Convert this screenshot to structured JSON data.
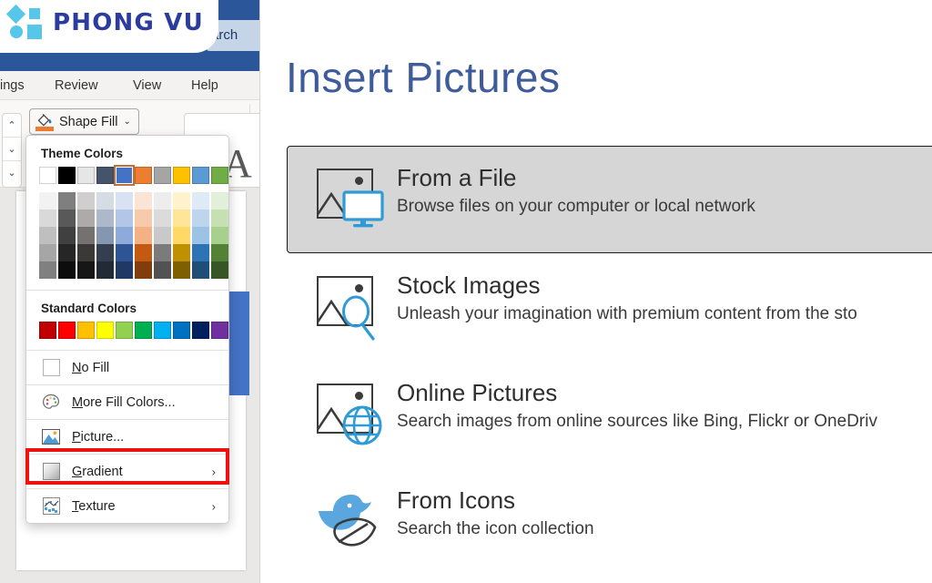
{
  "brand": {
    "name": "PHONG VU",
    "logo_icon": "phong-vu-diamond-square-logo",
    "accent_color": "#56c7e8",
    "text_color": "#2b3b9e"
  },
  "office_window": {
    "titlebar_color": "#2b579a",
    "search_box_text": "arch",
    "tabs": [
      {
        "label": "ings"
      },
      {
        "label": "Review"
      },
      {
        "label": "View"
      },
      {
        "label": "Help"
      }
    ],
    "spinners": [
      {
        "icon": "chevron-up-icon",
        "glyph": "⌃"
      },
      {
        "icon": "chevron-down-icon",
        "glyph": "⌄"
      },
      {
        "icon": "more-options-icon",
        "glyph": "⌄"
      }
    ],
    "ribbon": {
      "shape_fill_button": {
        "label": "Shape Fill",
        "icon": "paint-bucket-icon",
        "dropdown_glyph": "⌄",
        "fill_indicator_color": "#ed7d31"
      },
      "wordart_gallery_letter": "A"
    },
    "document_shape_color": "#4472c4"
  },
  "fill_menu": {
    "theme_colors_heading": "Theme Colors",
    "theme_colors": [
      {
        "name": "white-background-1",
        "hex": "#ffffff"
      },
      {
        "name": "black-text-1",
        "hex": "#000000"
      },
      {
        "name": "light-gray-background-2",
        "hex": "#e7e6e6"
      },
      {
        "name": "dark-blue-text-2",
        "hex": "#44546a"
      },
      {
        "name": "blue-accent-1",
        "hex": "#4472c4",
        "selected": true
      },
      {
        "name": "orange-accent-2",
        "hex": "#ed7d31"
      },
      {
        "name": "gray-accent-3",
        "hex": "#a5a5a5"
      },
      {
        "name": "gold-accent-4",
        "hex": "#ffc000"
      },
      {
        "name": "blue-accent-5",
        "hex": "#5b9bd5"
      },
      {
        "name": "green-accent-6",
        "hex": "#70ad47"
      }
    ],
    "theme_variants": [
      [
        "#f2f2f2",
        "#d9d9d9",
        "#bfbfbf",
        "#a6a6a6",
        "#808080"
      ],
      [
        "#7f7f7f",
        "#595959",
        "#404040",
        "#262626",
        "#0d0d0d"
      ],
      [
        "#d0cece",
        "#aeaaaa",
        "#757171",
        "#3b3838",
        "#161616"
      ],
      [
        "#d6dce4",
        "#adb9ca",
        "#8496b0",
        "#333f4f",
        "#222a35"
      ],
      [
        "#d9e2f3",
        "#b4c6e7",
        "#8eaadb",
        "#2e5496",
        "#1f3864"
      ],
      [
        "#fbe4d5",
        "#f7caac",
        "#f4b183",
        "#c45911",
        "#833c0b"
      ],
      [
        "#ededed",
        "#dbdbdb",
        "#c9c9c9",
        "#7b7b7b",
        "#525252"
      ],
      [
        "#fff2cc",
        "#ffe598",
        "#ffd965",
        "#bf9000",
        "#7f6000"
      ],
      [
        "#deeaf6",
        "#bdd6ee",
        "#9cc3e5",
        "#2e74b5",
        "#1f4e79"
      ],
      [
        "#e2efd9",
        "#c5e0b3",
        "#a8d08d",
        "#538135",
        "#375623"
      ]
    ],
    "standard_colors_heading": "Standard Colors",
    "standard_colors": [
      {
        "name": "dark-red",
        "hex": "#c00000"
      },
      {
        "name": "red",
        "hex": "#ff0000"
      },
      {
        "name": "orange",
        "hex": "#ffc000"
      },
      {
        "name": "yellow",
        "hex": "#ffff00"
      },
      {
        "name": "light-green",
        "hex": "#92d050"
      },
      {
        "name": "green",
        "hex": "#00b050"
      },
      {
        "name": "light-blue",
        "hex": "#00b0f0"
      },
      {
        "name": "blue",
        "hex": "#0070c0"
      },
      {
        "name": "dark-blue",
        "hex": "#002060"
      },
      {
        "name": "purple",
        "hex": "#7030a0"
      }
    ],
    "items": [
      {
        "name": "no-fill",
        "label_pre": "",
        "label_key": "N",
        "label_post": "o Fill",
        "icon": "empty-square-icon",
        "has_submenu": false
      },
      {
        "name": "more-fill-colors",
        "label_pre": "",
        "label_key": "M",
        "label_post": "ore Fill Colors...",
        "icon": "color-palette-icon",
        "has_submenu": false
      },
      {
        "name": "picture",
        "label_pre": "",
        "label_key": "P",
        "label_post": "icture...",
        "icon": "picture-icon",
        "has_submenu": false,
        "highlighted": true
      },
      {
        "name": "gradient",
        "label_pre": "",
        "label_key": "G",
        "label_post": "radient",
        "icon": "gradient-icon",
        "has_submenu": true,
        "chevron": "›"
      },
      {
        "name": "texture",
        "label_pre": "",
        "label_key": "T",
        "label_post": "exture",
        "icon": "texture-icon",
        "has_submenu": true,
        "chevron": "›"
      }
    ],
    "highlight_color": "#ee1111"
  },
  "insert_pictures": {
    "title": "Insert Pictures",
    "title_color": "#3f5c9a",
    "options": [
      {
        "name": "from-a-file",
        "heading": "From a File",
        "description": "Browse files on your computer or local network",
        "icon": "picture-with-monitor-icon",
        "selected": true
      },
      {
        "name": "stock-images",
        "heading": "Stock Images",
        "description": "Unleash your imagination with premium content from the sto",
        "icon": "picture-with-magnifier-icon",
        "selected": false
      },
      {
        "name": "online-pictures",
        "heading": "Online Pictures",
        "description": "Search images from online sources like Bing, Flickr or OneDriv",
        "icon": "picture-with-globe-icon",
        "selected": false
      },
      {
        "name": "from-icons",
        "heading": "From Icons",
        "description": "Search the icon collection",
        "icon": "duck-and-leaf-icon",
        "selected": false
      }
    ]
  }
}
